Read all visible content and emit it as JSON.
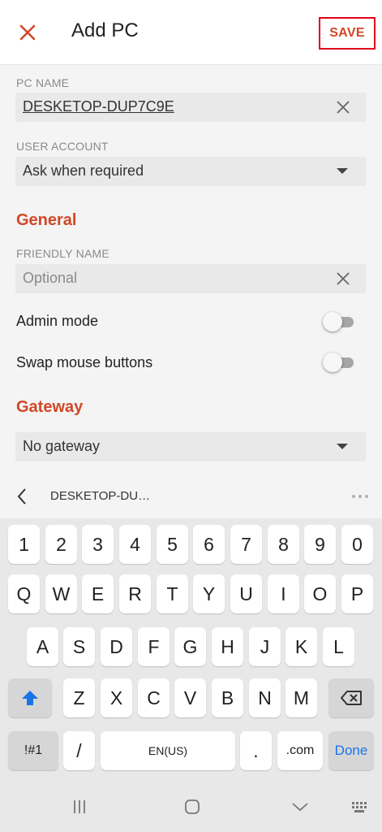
{
  "appbar": {
    "title": "Add PC",
    "save_label": "SAVE"
  },
  "pc_name": {
    "label": "PC NAME",
    "value": "DESKETOP-DUP7C9E"
  },
  "user_account": {
    "label": "USER ACCOUNT",
    "value": "Ask when required"
  },
  "general": {
    "title": "General",
    "friendly_name_label": "FRIENDLY NAME",
    "friendly_name_placeholder": "Optional",
    "admin_mode_label": "Admin mode",
    "admin_mode_on": false,
    "swap_mouse_label": "Swap mouse buttons",
    "swap_mouse_on": false
  },
  "gateway": {
    "title": "Gateway",
    "value": "No gateway"
  },
  "suggestion": {
    "text": "DESKETOP-DU…"
  },
  "keyboard": {
    "row_numbers": [
      "1",
      "2",
      "3",
      "4",
      "5",
      "6",
      "7",
      "8",
      "9",
      "0"
    ],
    "row_q": [
      "Q",
      "W",
      "E",
      "R",
      "T",
      "Y",
      "U",
      "I",
      "O",
      "P"
    ],
    "row_a": [
      "A",
      "S",
      "D",
      "F",
      "G",
      "H",
      "J",
      "K",
      "L"
    ],
    "row_z": [
      "Z",
      "X",
      "C",
      "V",
      "B",
      "N",
      "M"
    ],
    "symbols_label": "!#1",
    "slash_label": "/",
    "space_label": "EN(US)",
    "period_label": ".",
    "dotcom_label": ".com",
    "done_label": "Done"
  },
  "colors": {
    "accent": "#d24726",
    "highlight_border": "#e2001a",
    "done_blue": "#1a73e8"
  },
  "icons": [
    "close-icon",
    "clear-icon",
    "dropdown-caret-icon",
    "back-chevron-icon",
    "more-dots-icon",
    "shift-icon",
    "backspace-icon",
    "recents-icon",
    "home-icon",
    "back-icon",
    "keyboard-switch-icon"
  ]
}
